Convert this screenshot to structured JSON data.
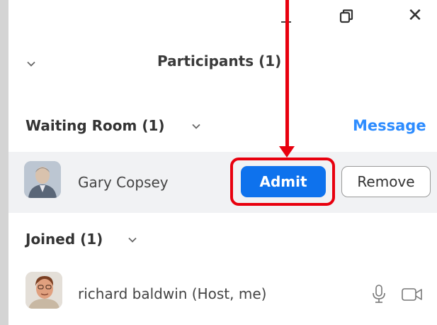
{
  "window": {
    "minimize_icon": "minimize-icon",
    "restore_icon": "restore-icon",
    "close_glyph": "✕"
  },
  "header": {
    "title": "Participants (1)",
    "collapse_icon": "chevron-down-icon"
  },
  "waiting_room": {
    "title": "Waiting Room (1)",
    "message_label": "Message",
    "participants": [
      {
        "name": "Gary Copsey",
        "admit_label": "Admit",
        "remove_label": "Remove"
      }
    ]
  },
  "joined": {
    "title": "Joined (1)",
    "participants": [
      {
        "name": "richard baldwin (Host, me)",
        "mic_icon": "microphone-icon",
        "video_icon": "video-camera-icon"
      }
    ]
  },
  "colors": {
    "accent_blue": "#0e72ed",
    "link_blue": "#2d8cff",
    "annotation_red": "#e8000e",
    "waiting_row_bg": "#f1f2f4"
  }
}
